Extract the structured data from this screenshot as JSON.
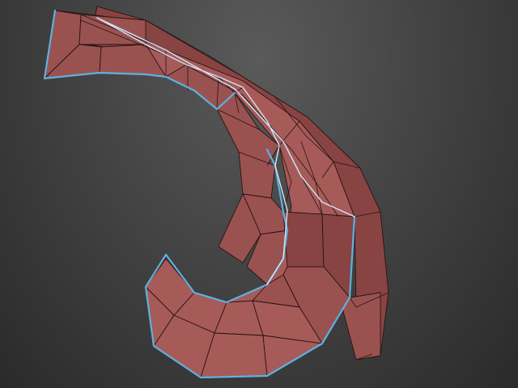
{
  "viewport": {
    "background_top": "#5a5a5a",
    "background_bottom": "#2a2a2a"
  },
  "mesh": {
    "face_color": "#9a5250",
    "wire_color": "#2a1312",
    "selection_color": "#5fb0e0",
    "selection_highlight": "#cfe6f7"
  }
}
